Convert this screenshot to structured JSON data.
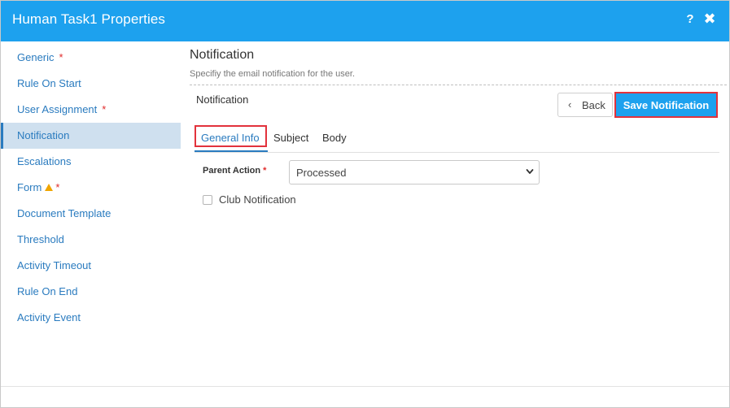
{
  "header": {
    "title": "Human Task1 Properties",
    "help_icon": "?",
    "close_icon": "✖"
  },
  "sidebar": {
    "items": [
      {
        "label": "Generic",
        "required": "*"
      },
      {
        "label": "Rule On Start"
      },
      {
        "label": "User Assignment",
        "required": "*"
      },
      {
        "label": "Notification",
        "active": true
      },
      {
        "label": "Escalations"
      },
      {
        "label": "Form",
        "required": "*",
        "warning": "warning-icon"
      },
      {
        "label": "Document Template"
      },
      {
        "label": "Threshold"
      },
      {
        "label": "Activity Timeout"
      },
      {
        "label": "Rule On End"
      },
      {
        "label": "Activity Event"
      }
    ]
  },
  "main": {
    "title": "Notification",
    "subtitle": "Specifiy the email notification for the user.",
    "sub_heading": "Notification",
    "back_button": "Back",
    "back_icon": "‹",
    "save_button": "Save Notification",
    "tabs": [
      {
        "label": "General Info",
        "active": true
      },
      {
        "label": "Subject"
      },
      {
        "label": "Body"
      }
    ],
    "form": {
      "parent_action_label": "Parent Action",
      "parent_action_required": "*",
      "parent_action_value": "Processed",
      "club_notification_label": "Club Notification",
      "club_notification_checked": false
    }
  },
  "colors": {
    "accent": "#1da1ee",
    "link": "#2a7bbf",
    "highlight": "#e2323c",
    "active_bg": "#cfe0ef"
  }
}
